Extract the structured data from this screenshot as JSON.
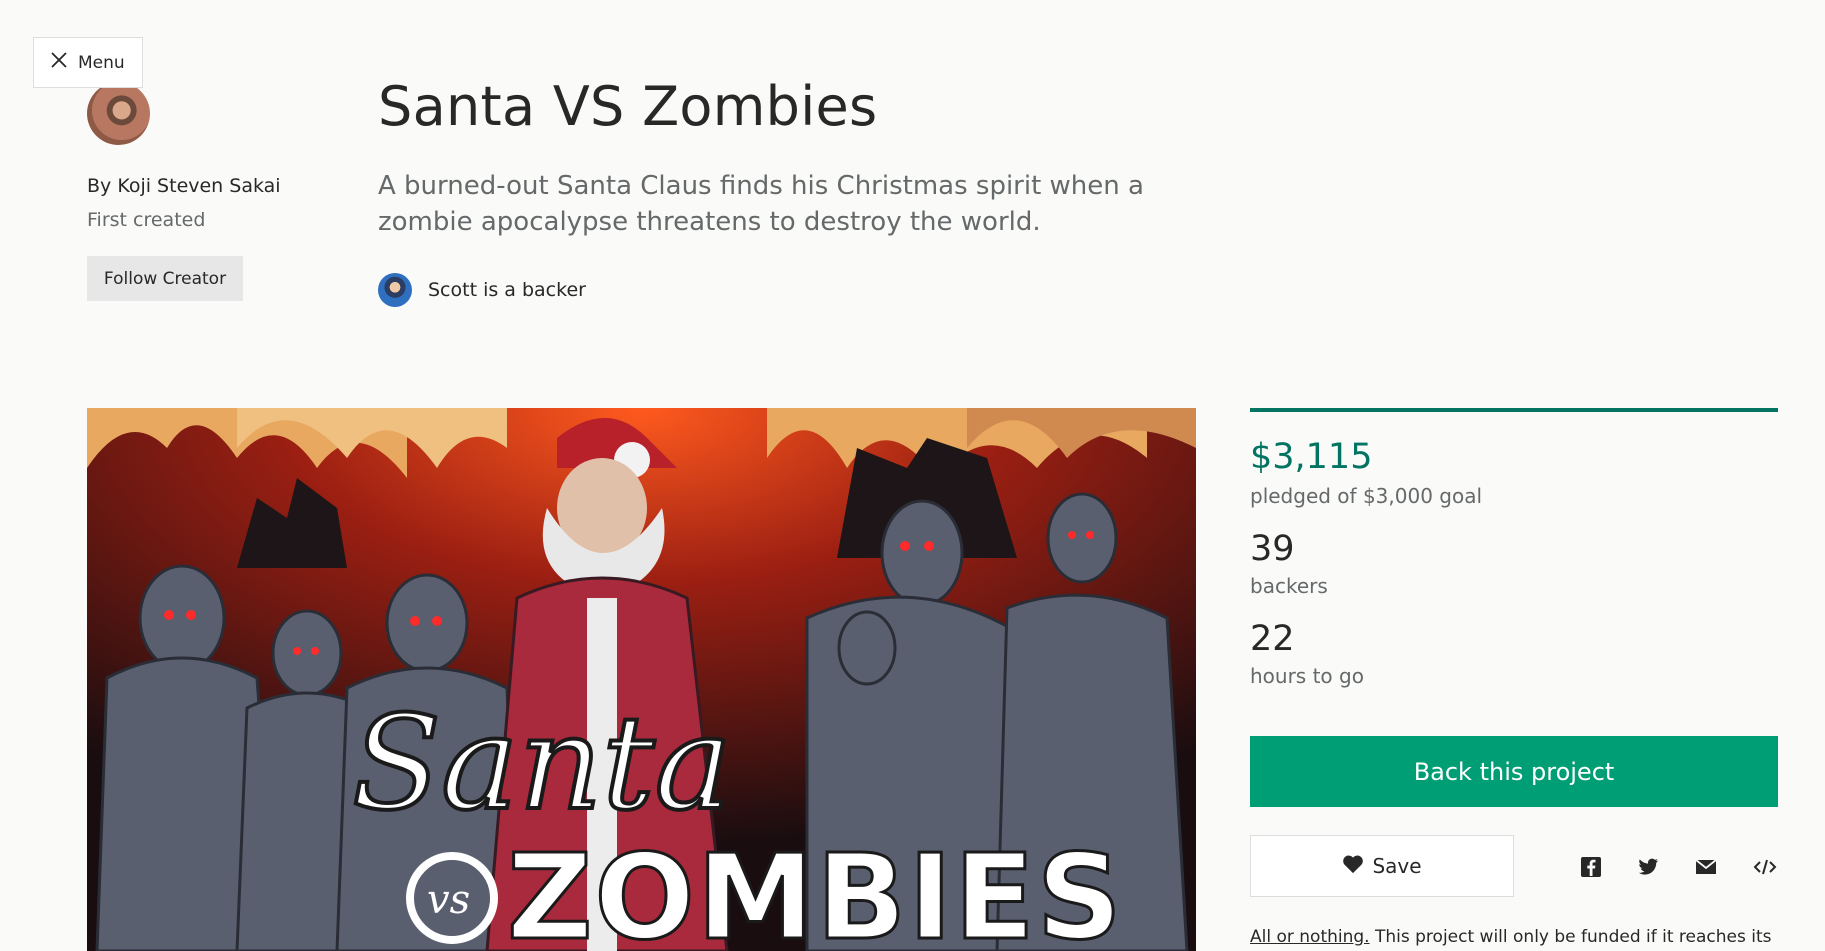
{
  "menu": {
    "label": "Menu",
    "icon": "close-icon"
  },
  "creator": {
    "by": "By Koji Steven Sakai",
    "first_created": "First created",
    "follow_label": "Follow Creator"
  },
  "project": {
    "title": "Santa VS Zombies",
    "blurb": "A burned-out Santa Claus finds his Christmas spirit when a zombie apocalypse threatens to destroy the world.",
    "backer_note": "Scott is a backer"
  },
  "hero": {
    "logo_text_line1": "Santa",
    "logo_text_vs": "vs",
    "logo_text_line2": "ZOMBIES"
  },
  "stats": {
    "pledged": "$3,115",
    "pledged_label": "pledged of $3,000 goal",
    "funded_fraction": 1.0,
    "backers": "39",
    "backers_label": "backers",
    "time_left": "22",
    "time_label": "hours to go"
  },
  "actions": {
    "back_label": "Back this project",
    "save_label": "Save"
  },
  "share": [
    "facebook-icon",
    "twitter-icon",
    "email-icon",
    "embed-icon"
  ],
  "all_or_nothing": {
    "link": "All or nothing.",
    "text": " This project will only be funded if it reaches its"
  },
  "colors": {
    "accent_green": "#037362",
    "button_green": "#009e74"
  }
}
